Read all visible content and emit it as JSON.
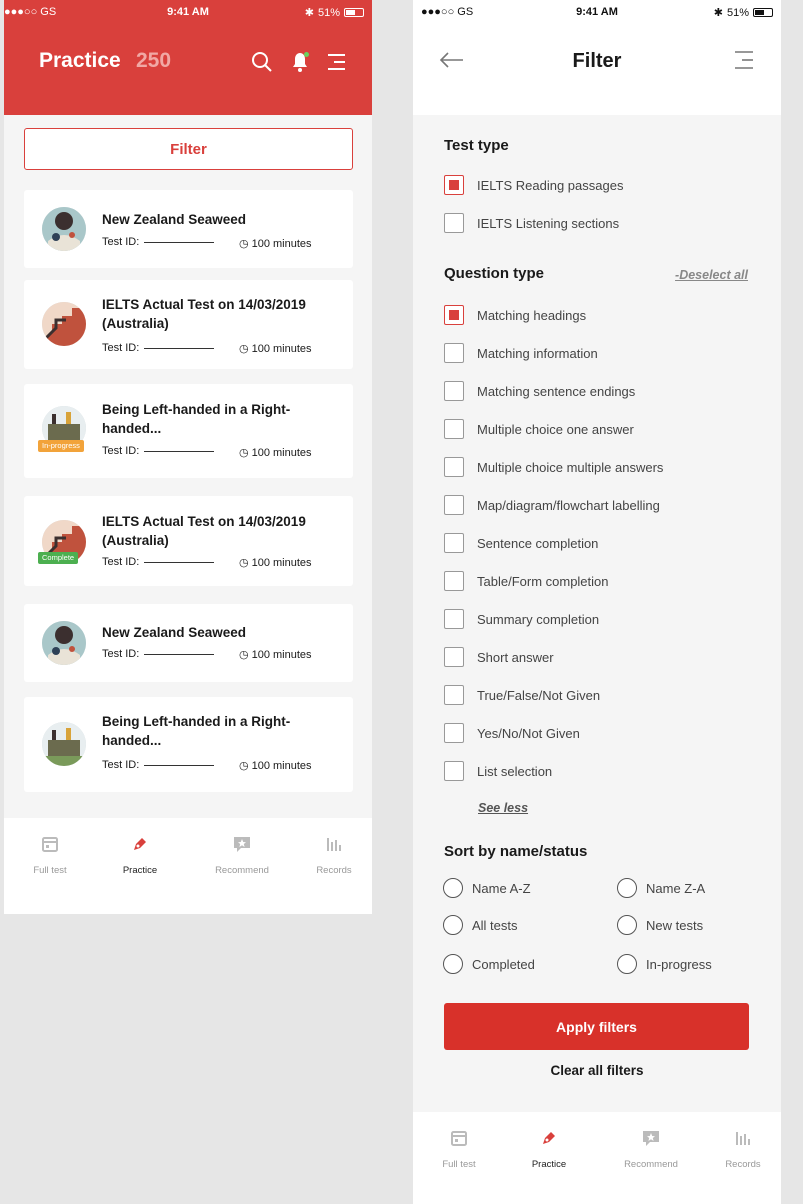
{
  "status": {
    "carrier": "●●●○○ GS",
    "time": "9:41 AM",
    "battery": "51%"
  },
  "practice": {
    "title": "Practice",
    "count": "250",
    "filter_label": "Filter",
    "test_id_label": "Test ID:",
    "cards": [
      {
        "title": "New Zealand Seaweed",
        "duration": "100 minutes",
        "badge": "",
        "thumb": "seaweed"
      },
      {
        "title": "IELTS Actual Test on 14/03/2019 (Australia)",
        "duration": "100 minutes",
        "badge": "",
        "thumb": "stairs"
      },
      {
        "title": "Being Left-handed in a Right-handed...",
        "duration": "100 minutes",
        "badge": "In-progress",
        "thumb": "office"
      },
      {
        "title": "IELTS Actual Test on 14/03/2019 (Australia)",
        "duration": "100 minutes",
        "badge": "Complete",
        "thumb": "stairs"
      },
      {
        "title": "New Zealand Seaweed",
        "duration": "100 minutes",
        "badge": "",
        "thumb": "seaweed"
      },
      {
        "title": "Being Left-handed in a Right-handed...",
        "duration": "100 minutes",
        "badge": "",
        "thumb": "office"
      }
    ]
  },
  "tabs": [
    {
      "label": "Full test",
      "icon": "calendar-icon",
      "active": false
    },
    {
      "label": "Practice",
      "icon": "pen-icon",
      "active": true
    },
    {
      "label": "Recommend",
      "icon": "star-chat-icon",
      "active": false
    },
    {
      "label": "Records",
      "icon": "bar-chart-icon",
      "active": false
    }
  ],
  "filter": {
    "title": "Filter",
    "test_type_title": "Test type",
    "test_types": [
      {
        "label": "IELTS Reading passages",
        "checked": true
      },
      {
        "label": "IELTS Listening sections",
        "checked": false
      }
    ],
    "question_type_title": "Question type",
    "deselect_all": "-Deselect all",
    "question_types": [
      {
        "label": "Matching headings",
        "checked": true
      },
      {
        "label": "Matching information",
        "checked": false
      },
      {
        "label": "Matching sentence endings",
        "checked": false
      },
      {
        "label": "Multiple choice one answer",
        "checked": false
      },
      {
        "label": "Multiple choice multiple answers",
        "checked": false
      },
      {
        "label": "Map/diagram/flowchart labelling",
        "checked": false
      },
      {
        "label": "Sentence completion",
        "checked": false
      },
      {
        "label": "Table/Form completion",
        "checked": false
      },
      {
        "label": "Summary completion",
        "checked": false
      },
      {
        "label": "Short answer",
        "checked": false
      },
      {
        "label": "True/False/Not Given",
        "checked": false
      },
      {
        "label": "Yes/No/Not Given",
        "checked": false
      },
      {
        "label": "List selection",
        "checked": false
      }
    ],
    "see_less": "See less",
    "sort_title": "Sort by name/status",
    "sort_options": [
      "Name A-Z",
      "Name Z-A",
      "All tests",
      "New tests",
      "Completed",
      "In-progress"
    ],
    "apply_label": "Apply filters",
    "clear_label": "Clear all filters"
  },
  "colors": {
    "accent": "#d9403c",
    "apply": "#d8312a",
    "in_progress": "#f2a33a",
    "complete": "#4caf50"
  }
}
